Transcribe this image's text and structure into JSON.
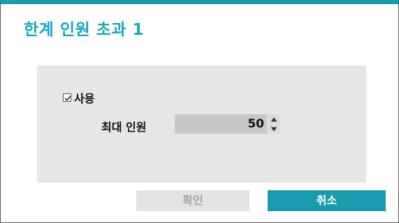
{
  "dialog": {
    "title": "한계 인원 초과 1"
  },
  "settings": {
    "use_checkbox": {
      "label": "사용",
      "checked": true
    },
    "max_people": {
      "label": "최대 인원",
      "value": "50"
    }
  },
  "buttons": {
    "ok_label": "확인",
    "ok_enabled": false,
    "cancel_label": "취소"
  },
  "colors": {
    "accent": "#1a9aad",
    "title": "#1aa6bd",
    "panel_bg": "#e6e6e6",
    "disabled_text": "#a4a4a4"
  },
  "icons": {
    "checkbox": "check-icon",
    "spin_up": "arrow-up-icon",
    "spin_down": "arrow-down-icon"
  }
}
